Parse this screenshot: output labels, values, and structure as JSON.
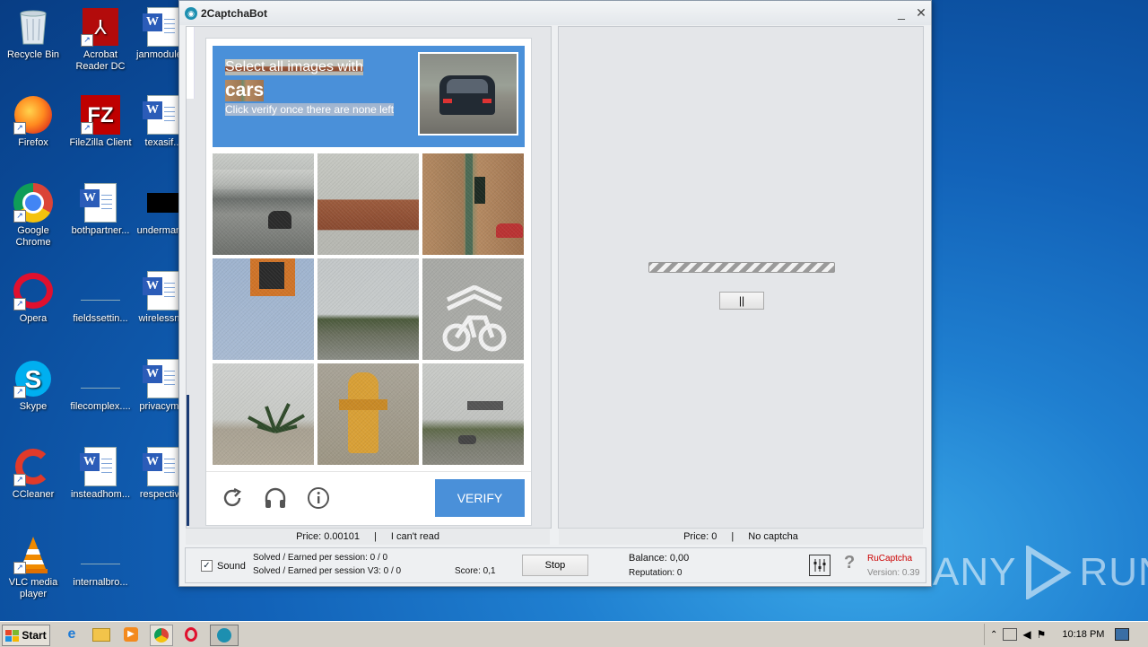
{
  "desktop": {
    "icons": [
      {
        "label": "Recycle Bin"
      },
      {
        "label": "Acrobat Reader DC"
      },
      {
        "label": "janmodule..."
      },
      {
        "label": "Firefox"
      },
      {
        "label": "FileZilla Client"
      },
      {
        "label": "texasif..."
      },
      {
        "label": "Google Chrome"
      },
      {
        "label": "bothpartner..."
      },
      {
        "label": "underman..."
      },
      {
        "label": "Opera"
      },
      {
        "label": "fieldssettin..."
      },
      {
        "label": "wirelessn..."
      },
      {
        "label": "Skype"
      },
      {
        "label": "filecomplex...."
      },
      {
        "label": "privacym..."
      },
      {
        "label": "CCleaner"
      },
      {
        "label": "insteadhom..."
      },
      {
        "label": "respectiv..."
      },
      {
        "label": "VLC media player"
      },
      {
        "label": "internalbro..."
      }
    ]
  },
  "window": {
    "title": "2CaptchaBot",
    "min_glyph": "_",
    "close_glyph": "✕"
  },
  "captcha": {
    "line1": "Select all images with",
    "keyword": "cars",
    "line3": "Click verify once there are none left",
    "verify_label": "VERIFY",
    "tiles": [
      "street with motorcycle",
      "roof",
      "traffic light",
      "sign",
      "road with trees",
      "bike lane marking",
      "palm plant",
      "fire hydrant",
      "highway with car"
    ]
  },
  "left_status": {
    "price": "Price: 0.00101",
    "separator": "|",
    "cant_read": "I can't read"
  },
  "right_status": {
    "price": "Price: 0",
    "separator": "|",
    "no_captcha": "No captcha"
  },
  "right_panel": {
    "pause_label": "||"
  },
  "bottom": {
    "sound_label": "Sound",
    "sound_checked": true,
    "solved": "Solved / Earned per session: 0 / 0",
    "solved_v3": "Solved / Earned per session V3: 0 / 0",
    "score": "Score: 0,1",
    "stop_label": "Stop",
    "balance": "Balance:  0,00",
    "reputation": "Reputation: 0",
    "help_glyph": "?",
    "service": "RuCaptcha",
    "version": "Version: 0.39"
  },
  "watermark": {
    "left": "ANY",
    "right": "RUN"
  },
  "taskbar": {
    "start_label": "Start",
    "clock": "10:18 PM"
  },
  "colors": {
    "accent": "#4a90d9",
    "service_red": "#cc0000"
  }
}
